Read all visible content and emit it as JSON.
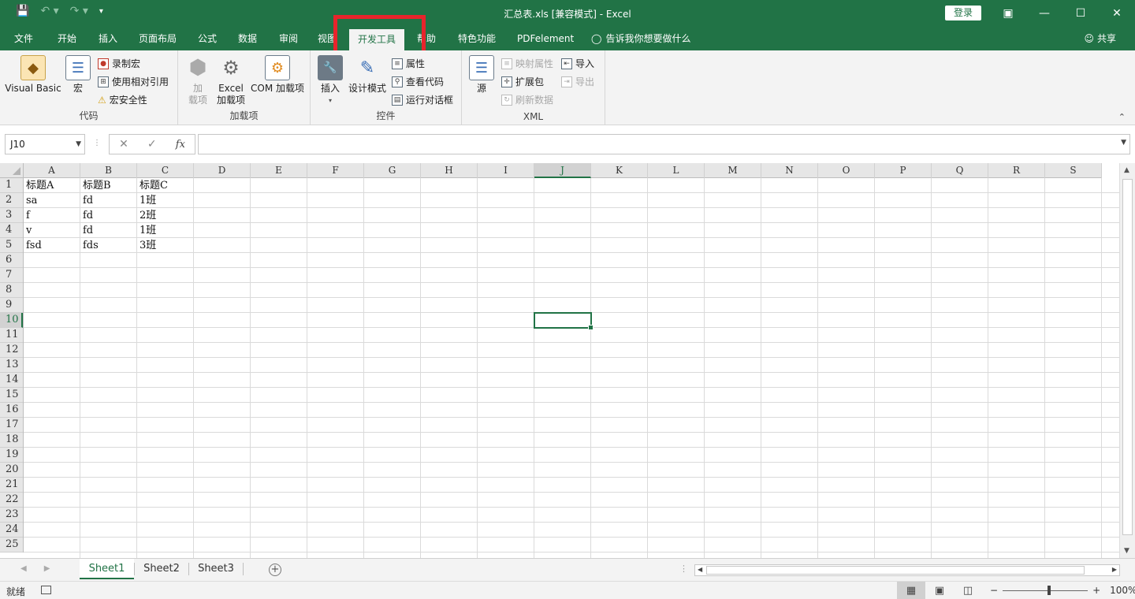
{
  "window": {
    "title": "汇总表.xls  [兼容模式]  -  Excel",
    "login": "登录",
    "qat": [
      "save",
      "undo",
      "redo",
      "customize"
    ]
  },
  "ribbon_tabs": [
    "文件",
    "开始",
    "插入",
    "页面布局",
    "公式",
    "数据",
    "审阅",
    "视图",
    "开发工具",
    "帮助",
    "特色功能",
    "PDFelement"
  ],
  "active_tab": "开发工具",
  "tell_me": "告诉我你想要做什么",
  "share": "共享",
  "groups": {
    "code": {
      "label": "代码",
      "visual_basic": "Visual Basic",
      "macros": "宏",
      "record_macro": "录制宏",
      "relative_ref": "使用相对引用",
      "macro_security": "宏安全性"
    },
    "addins": {
      "label": "加载项",
      "addins_btn": "加\n载项",
      "excel_addins": "Excel\n加载项",
      "com_addins": "COM 加载项"
    },
    "controls": {
      "label": "控件",
      "insert": "插入",
      "design_mode": "设计模式",
      "properties": "属性",
      "view_code": "查看代码",
      "run_dialog": "运行对话框"
    },
    "xml": {
      "label": "XML",
      "source": "源",
      "map_props": "映射属性",
      "expansion_packs": "扩展包",
      "refresh_data": "刷新数据",
      "import": "导入",
      "export": "导出"
    }
  },
  "formula_bar": {
    "name_box": "J10",
    "fx": "fx",
    "value": ""
  },
  "columns": [
    "A",
    "B",
    "C",
    "D",
    "E",
    "F",
    "G",
    "H",
    "I",
    "J",
    "K",
    "L",
    "M",
    "N",
    "O",
    "P",
    "Q",
    "R",
    "S"
  ],
  "rows": [
    "1",
    "2",
    "3",
    "4",
    "5",
    "6",
    "7",
    "8",
    "9",
    "10",
    "11",
    "12",
    "13",
    "14",
    "15",
    "16",
    "17",
    "18",
    "19",
    "20",
    "21",
    "22",
    "23",
    "24",
    "25"
  ],
  "selected_cell": "J10",
  "table": [
    [
      "标题A",
      "标题B",
      "标题C"
    ],
    [
      "sa",
      "fd",
      "1班"
    ],
    [
      "f",
      "fd",
      "2班"
    ],
    [
      "v",
      "fd",
      "1班"
    ],
    [
      "fsd",
      "fds",
      "3班"
    ]
  ],
  "sheets": [
    "Sheet1",
    "Sheet2",
    "Sheet3"
  ],
  "active_sheet": "Sheet1",
  "status": {
    "ready": "就绪",
    "zoom": "100%"
  },
  "colors": {
    "excel_green": "#217346",
    "highlight_red": "#e8242c"
  }
}
